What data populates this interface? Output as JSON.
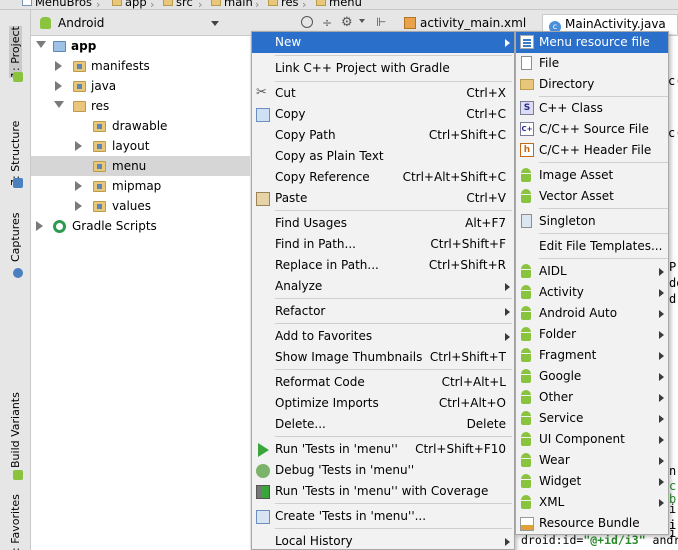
{
  "breadcrumb": {
    "items": [
      "MenuBros",
      "app",
      "src",
      "main",
      "res",
      "menu"
    ]
  },
  "left_strip": {
    "tabs": [
      "1: Project",
      "7: Structure",
      "Captures",
      "Build Variants",
      "2: Favorites"
    ]
  },
  "project_view": {
    "selected_view": "Android"
  },
  "editor": {
    "tabs": [
      "activity_main.xml",
      "MainActivity.java"
    ],
    "code_fragments": [
      "c(",
      "c(",
      "P",
      "de",
      "d,",
      "n",
      "c",
      "b",
      "ir",
      "ir",
      "ir",
      "ir"
    ],
    "bottom_line": {
      "prefix": "droid:id=",
      "value": "\"@+id/i3\"",
      "suffix": " andr"
    }
  },
  "tree": {
    "items": [
      {
        "label": "app",
        "bold": true
      },
      {
        "label": "manifests"
      },
      {
        "label": "java"
      },
      {
        "label": "res"
      },
      {
        "label": "drawable"
      },
      {
        "label": "layout"
      },
      {
        "label": "menu",
        "selected": true
      },
      {
        "label": "mipmap"
      },
      {
        "label": "values"
      },
      {
        "label": "Gradle Scripts"
      }
    ]
  },
  "context_menu": {
    "items": [
      {
        "label": "New",
        "shortcut": "",
        "has_submenu": true,
        "highlighted": true
      },
      {
        "label": "Link C++ Project with Gradle",
        "shortcut": ""
      },
      {
        "label": "Cut",
        "shortcut": "Ctrl+X",
        "icon": "scissors-icon"
      },
      {
        "label": "Copy",
        "shortcut": "Ctrl+C",
        "icon": "copy-icon"
      },
      {
        "label": "Copy Path",
        "shortcut": "Ctrl+Shift+C"
      },
      {
        "label": "Copy as Plain Text",
        "shortcut": ""
      },
      {
        "label": "Copy Reference",
        "shortcut": "Ctrl+Alt+Shift+C"
      },
      {
        "label": "Paste",
        "shortcut": "Ctrl+V",
        "icon": "paste-icon"
      },
      {
        "label": "Find Usages",
        "shortcut": "Alt+F7"
      },
      {
        "label": "Find in Path...",
        "shortcut": "Ctrl+Shift+F"
      },
      {
        "label": "Replace in Path...",
        "shortcut": "Ctrl+Shift+R"
      },
      {
        "label": "Analyze",
        "shortcut": "",
        "has_submenu": true
      },
      {
        "label": "Refactor",
        "shortcut": "",
        "has_submenu": true
      },
      {
        "label": "Add to Favorites",
        "shortcut": "",
        "has_submenu": true
      },
      {
        "label": "Show Image Thumbnails",
        "shortcut": "Ctrl+Shift+T"
      },
      {
        "label": "Reformat Code",
        "shortcut": "Ctrl+Alt+L"
      },
      {
        "label": "Optimize Imports",
        "shortcut": "Ctrl+Alt+O"
      },
      {
        "label": "Delete...",
        "shortcut": "Delete"
      },
      {
        "label": "Run 'Tests in 'menu''",
        "shortcut": "Ctrl+Shift+F10",
        "icon": "run-icon"
      },
      {
        "label": "Debug 'Tests in 'menu''",
        "shortcut": "",
        "icon": "debug-icon"
      },
      {
        "label": "Run 'Tests in 'menu'' with Coverage",
        "shortcut": "",
        "icon": "coverage-icon"
      },
      {
        "label": "Create 'Tests in 'menu''...",
        "shortcut": "",
        "icon": "create-test-icon"
      },
      {
        "label": "Local History",
        "shortcut": "",
        "has_submenu": true
      }
    ]
  },
  "submenu": {
    "items": [
      {
        "label": "Menu resource file",
        "highlighted": true,
        "icon": "menu-resource-icon"
      },
      {
        "label": "File",
        "icon": "file-icon"
      },
      {
        "label": "Directory",
        "icon": "folder-icon"
      },
      {
        "label": "C++ Class",
        "icon": "cpp-class-icon"
      },
      {
        "label": "C/C++ Source File",
        "icon": "cpp-source-icon"
      },
      {
        "label": "C/C++ Header File",
        "icon": "cpp-header-icon"
      },
      {
        "label": "Image Asset",
        "icon": "android-icon"
      },
      {
        "label": "Vector Asset",
        "icon": "android-icon"
      },
      {
        "label": "Singleton",
        "icon": "singleton-icon"
      },
      {
        "label": "Edit File Templates...",
        "icon": ""
      },
      {
        "label": "AIDL",
        "icon": "android-icon",
        "has_submenu": true
      },
      {
        "label": "Activity",
        "icon": "android-icon",
        "has_submenu": true
      },
      {
        "label": "Android Auto",
        "icon": "android-icon",
        "has_submenu": true
      },
      {
        "label": "Folder",
        "icon": "android-icon",
        "has_submenu": true
      },
      {
        "label": "Fragment",
        "icon": "android-icon",
        "has_submenu": true
      },
      {
        "label": "Google",
        "icon": "android-icon",
        "has_submenu": true
      },
      {
        "label": "Other",
        "icon": "android-icon",
        "has_submenu": true
      },
      {
        "label": "Service",
        "icon": "android-icon",
        "has_submenu": true
      },
      {
        "label": "UI Component",
        "icon": "android-icon",
        "has_submenu": true
      },
      {
        "label": "Wear",
        "icon": "android-icon",
        "has_submenu": true
      },
      {
        "label": "Widget",
        "icon": "android-icon",
        "has_submenu": true
      },
      {
        "label": "XML",
        "icon": "android-icon",
        "has_submenu": true
      },
      {
        "label": "Resource Bundle",
        "icon": "resource-bundle-icon"
      }
    ]
  },
  "colors": {
    "highlight": "#2a6fc9",
    "android_green": "#8ac43f"
  }
}
